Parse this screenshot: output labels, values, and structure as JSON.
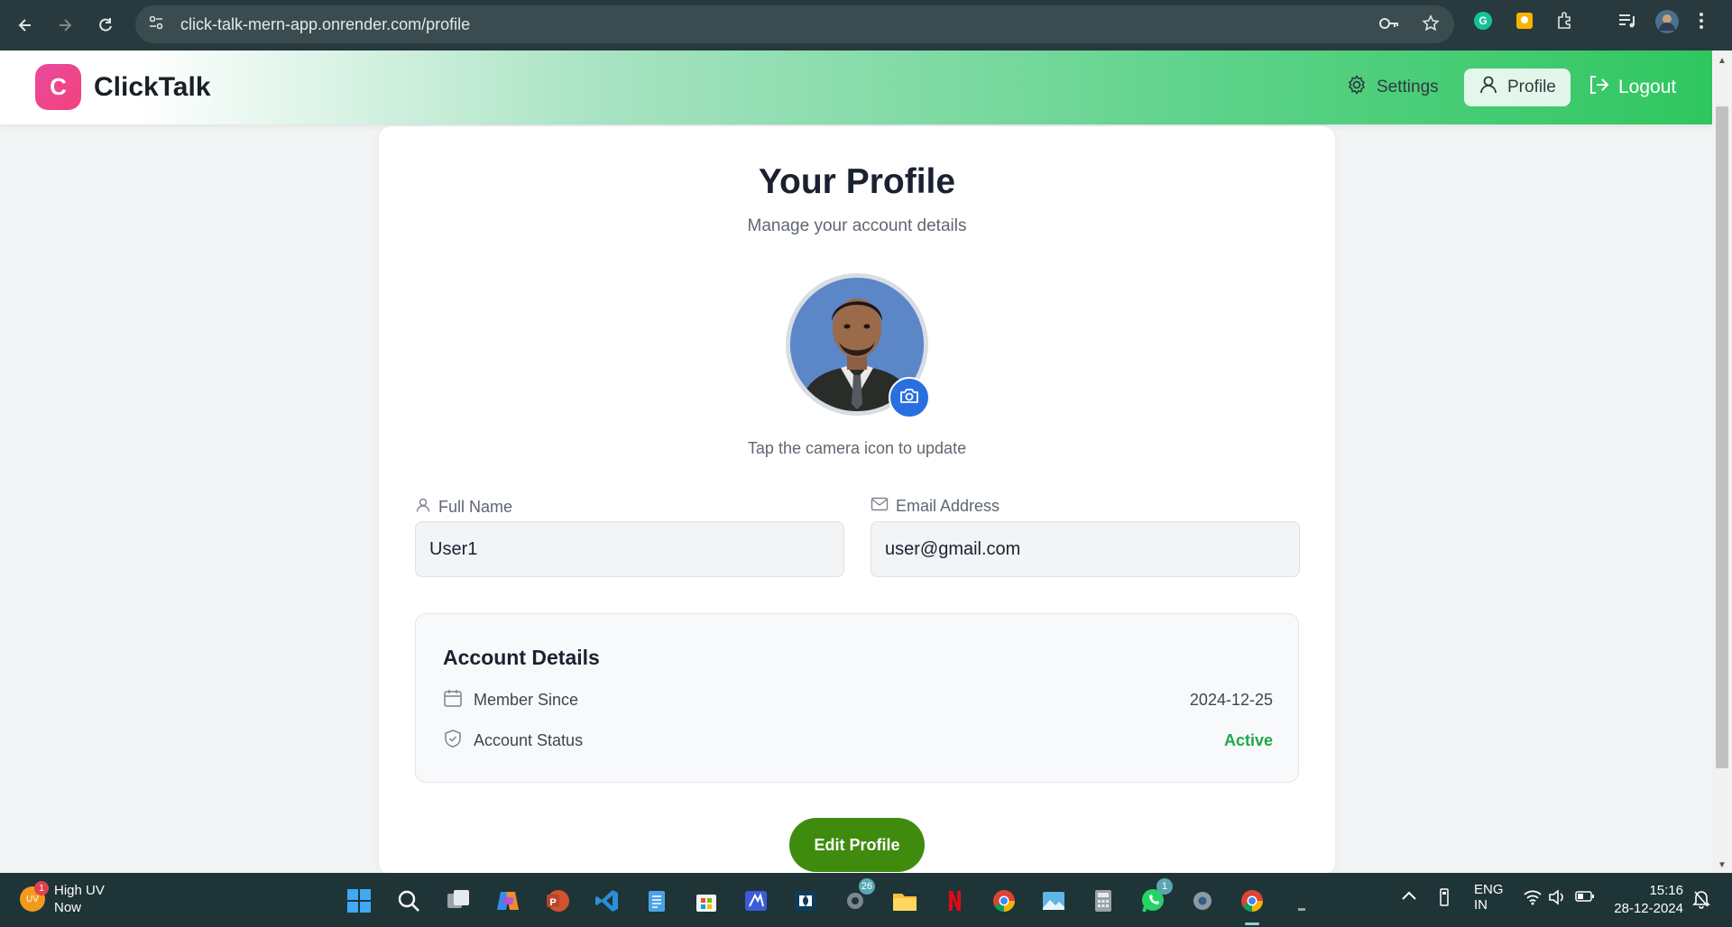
{
  "browser": {
    "url": "click-talk-mern-app.onrender.com/profile"
  },
  "header": {
    "logo_letter": "C",
    "brand": "ClickTalk",
    "settings_label": "Settings",
    "profile_label": "Profile",
    "logout_label": "Logout"
  },
  "profile": {
    "title": "Your Profile",
    "subtitle": "Manage your account details",
    "camera_hint": "Tap the camera icon to update",
    "full_name_label": "Full Name",
    "full_name_value": "User1",
    "email_label": "Email Address",
    "email_value": "user@gmail.com"
  },
  "account_details": {
    "title": "Account Details",
    "member_since_label": "Member Since",
    "member_since_value": "2024-12-25",
    "status_label": "Account Status",
    "status_value": "Active",
    "status_color": "#1ea84b"
  },
  "edit_button_label": "Edit Profile",
  "taskbar": {
    "weather_icon_text": "UV",
    "weather_badge": "1",
    "weather_title": "High UV",
    "weather_time": "Now",
    "store_badge": "26",
    "whatsapp_badge": "1",
    "lang_line1": "ENG",
    "lang_line2": "IN",
    "time": "15:16",
    "date": "28-12-2024"
  },
  "colors": {
    "accent_green": "#3f8b0d",
    "camera_blue": "#2a6fe0",
    "logo_pink": "#f5427a"
  }
}
